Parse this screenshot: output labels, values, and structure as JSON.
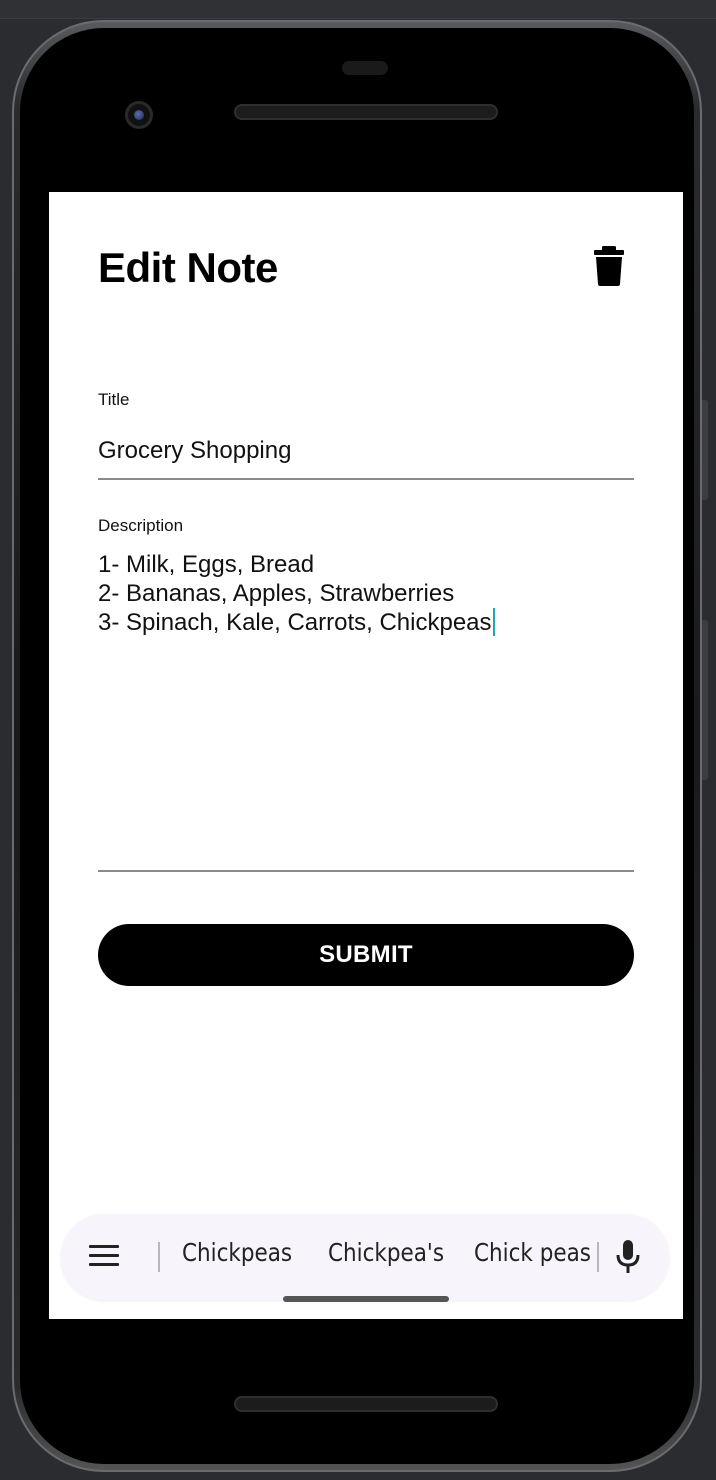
{
  "page": {
    "title": "Edit Note"
  },
  "form": {
    "title_label": "Title",
    "title_value": "Grocery Shopping",
    "description_label": "Description",
    "description_lines": [
      "1- Milk, Eggs, Bread",
      "2- Bananas, Apples, Strawberries",
      "3- Spinach, Kale, Carrots, Chickpeas"
    ],
    "submit_label": "SUBMIT"
  },
  "keyboard": {
    "suggestions": [
      "Chickpeas",
      "Chickpea's",
      "Chick peas"
    ],
    "menu_icon": "menu-icon",
    "mic_icon": "mic-icon"
  },
  "icons": {
    "delete": "trash-icon"
  },
  "colors": {
    "accent": "#000000",
    "caret": "#1fa8b0",
    "keyboard_bar": "#f7f4fb"
  }
}
